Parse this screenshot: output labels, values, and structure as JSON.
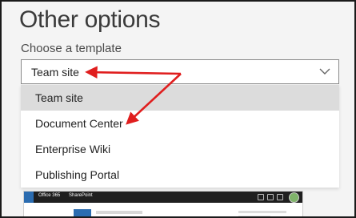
{
  "title": "Other options",
  "template": {
    "label": "Choose a template",
    "selected": "Team site",
    "options": [
      "Team site",
      "Document Center",
      "Enterprise Wiki",
      "Publishing Portal"
    ]
  },
  "preview": {
    "app_name": "Office 365",
    "product": "SharePoint"
  },
  "colors": {
    "annotation_arrow": "#e01e1e",
    "highlight": "#dcdcdc",
    "suite_bar": "#1f1f1f"
  }
}
